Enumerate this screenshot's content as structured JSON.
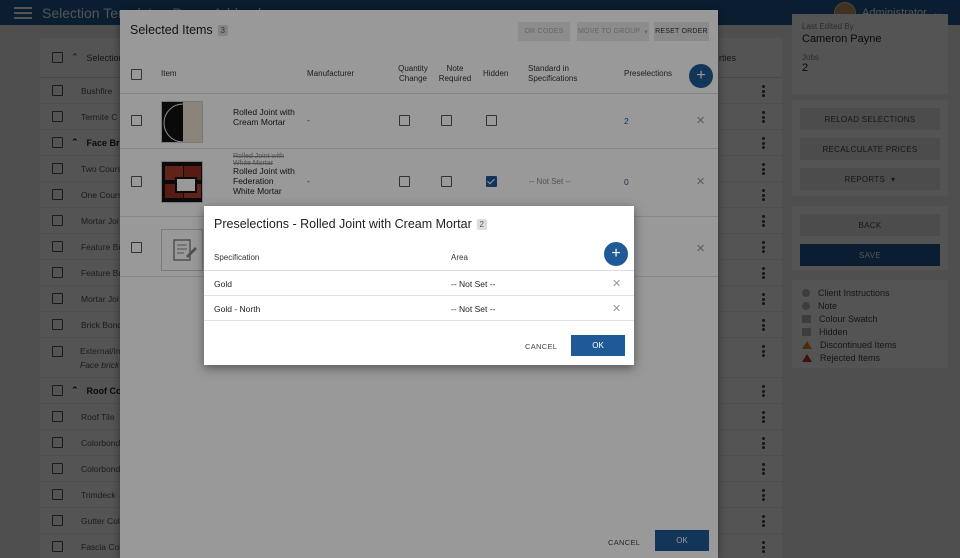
{
  "appbar": {
    "title": "Selection Template - Demo Addenda",
    "user": "Administrator"
  },
  "background_list": {
    "header": "Selection",
    "header_right": "rties",
    "rows": [
      {
        "label": "Bushfire",
        "group": false
      },
      {
        "label": "Termite C",
        "group": false
      },
      {
        "label": "Face Brick",
        "group": true
      },
      {
        "label": "Two Course",
        "group": false
      },
      {
        "label": "One Course",
        "group": false
      },
      {
        "label": "Mortar Joi",
        "group": false
      },
      {
        "label": "Feature Bri",
        "group": false
      },
      {
        "label": "Feature Bri",
        "group": false
      },
      {
        "label": "Mortar Joi",
        "group": false
      },
      {
        "label": "Brick Bond",
        "group": false
      },
      {
        "label": "External/Int",
        "group": false
      },
      {
        "label": "Roof Cove",
        "group": true
      },
      {
        "label": "Roof Tile",
        "group": false
      },
      {
        "label": "Colorbond",
        "group": false
      },
      {
        "label": "Colorbond",
        "group": false
      },
      {
        "label": "Trimdeck",
        "group": false
      },
      {
        "label": "Gutter Colo",
        "group": false
      },
      {
        "label": "Fascia Colo",
        "group": false
      }
    ],
    "face_brick_note": "Face brick s"
  },
  "right_panel": {
    "last_edited_label": "Last Edited By",
    "last_edited_value": "Cameron Payne",
    "jobs_label": "Jobs",
    "jobs_value": "2",
    "reload": "RELOAD SELECTIONS",
    "recalculate": "RECALCULATE PRICES",
    "reports": "REPORTS",
    "back": "BACK",
    "save": "SAVE",
    "legend": [
      {
        "label": "Client Instructions",
        "shape": "dot"
      },
      {
        "label": "Note",
        "shape": "dot"
      },
      {
        "label": "Colour Swatch",
        "shape": "square"
      },
      {
        "label": "Hidden",
        "shape": "square"
      },
      {
        "label": "Discontinued Items",
        "shape": "tri-orange"
      },
      {
        "label": "Rejected Items",
        "shape": "tri-red"
      }
    ]
  },
  "selected_items_dialog": {
    "title": "Selected Items",
    "count": "3",
    "toolbar": {
      "options": "OR CODES",
      "move": "MOVE TO GROUP",
      "reset": "RESET ORDER"
    },
    "columns": {
      "item": "Item",
      "manufacturer": "Manufacturer",
      "quantity_change": "Quantity Change",
      "note_required": "Note Required",
      "hidden": "Hidden",
      "standard": "Standard in Specifications",
      "preselections": "Preselections"
    },
    "rows": [
      {
        "old_name": "",
        "name": "Rolled Joint with Cream Mortar",
        "manufacturer": "-",
        "hidden": false,
        "standard": "",
        "preselections": "2"
      },
      {
        "old_name": "Rolled Joint with White Mortar",
        "name": "Rolled Joint with Federation White Mortar",
        "manufacturer": "-",
        "hidden": true,
        "standard": "-- Not Set --",
        "preselections": "0"
      },
      {
        "old_name": "",
        "name": "",
        "manufacturer": "",
        "hidden": false,
        "standard": "",
        "preselections": ""
      }
    ],
    "cancel": "CANCEL",
    "ok": "OK"
  },
  "preselections_dialog": {
    "title": "Preselections - Rolled Joint with Cream Mortar",
    "count": "2",
    "columns": {
      "specification": "Specification",
      "area": "Area"
    },
    "rows": [
      {
        "specification": "Gold",
        "area": "-- Not Set --"
      },
      {
        "specification": "Gold - North",
        "area": "-- Not Set --"
      }
    ],
    "cancel": "CANCEL",
    "ok": "OK"
  },
  "colors": {
    "primary": "#1f5a96",
    "overlay": "#000000"
  }
}
